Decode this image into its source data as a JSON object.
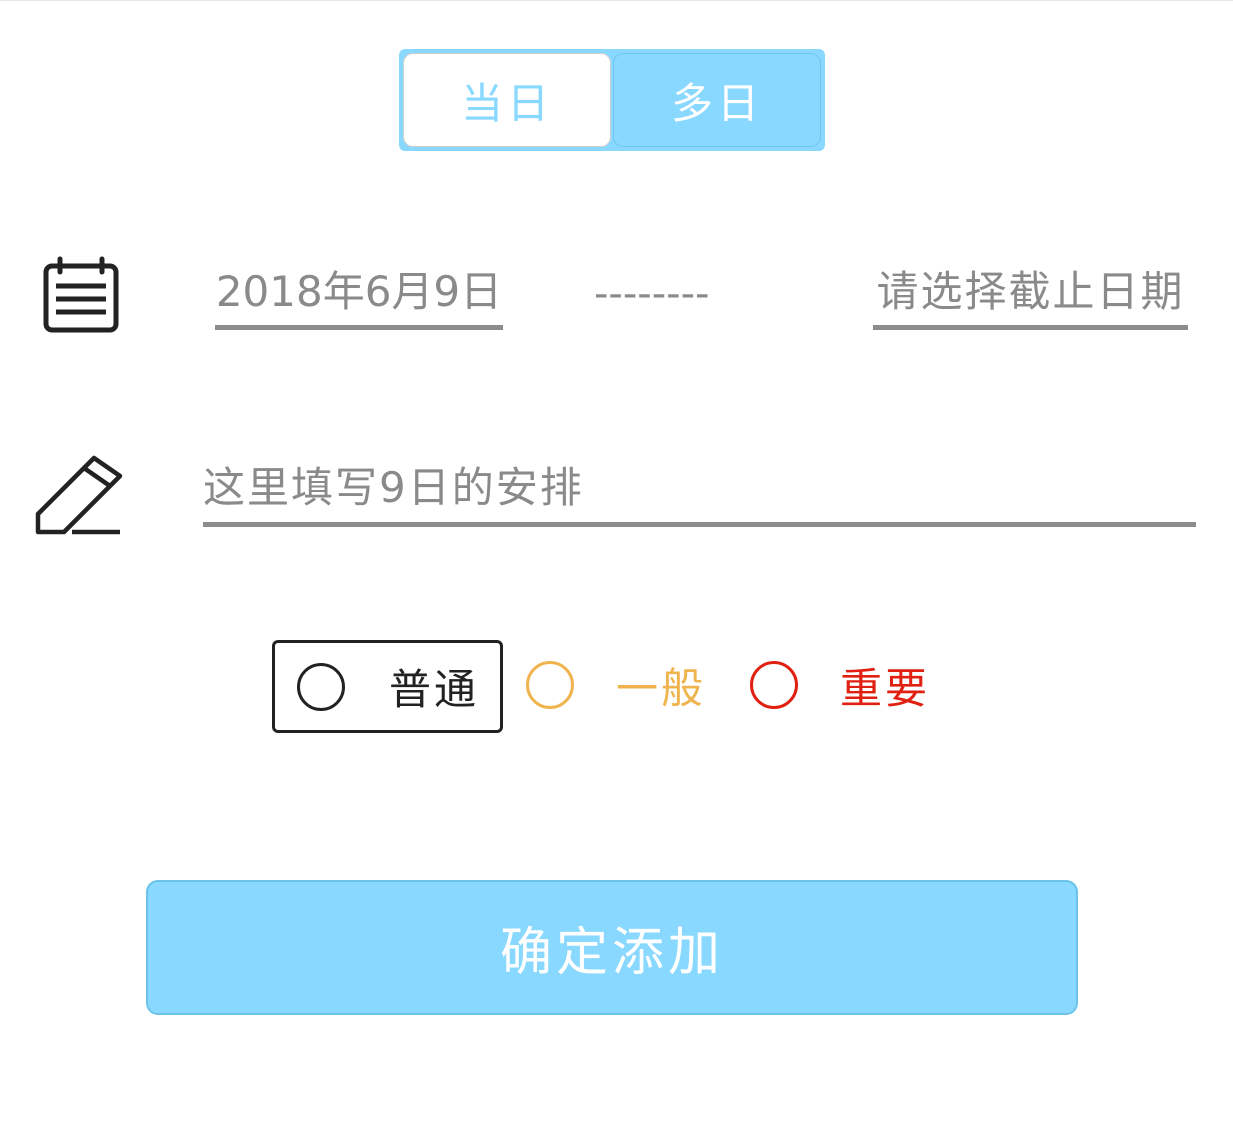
{
  "mode_toggle": {
    "single_day": "当日",
    "multi_day": "多日",
    "selected": "multi_day"
  },
  "date_range": {
    "start_date": "2018年6月9日",
    "separator": "--------",
    "end_date_placeholder": "请选择截止日期",
    "icon": "calendar-icon"
  },
  "plan": {
    "placeholder": "这里填写9日的安排",
    "value": "",
    "icon": "pencil-icon"
  },
  "priority": {
    "selected": "normal",
    "options": [
      {
        "key": "normal",
        "label": "普通",
        "color": "#222222"
      },
      {
        "key": "medium",
        "label": "一般",
        "color": "#f0b44f"
      },
      {
        "key": "important",
        "label": "重要",
        "color": "#e02010"
      }
    ]
  },
  "submit": {
    "label": "确定添加"
  },
  "colors": {
    "accent": "#88d8ff",
    "underline": "#8c8c8c",
    "muted_text": "#8a8a8a"
  }
}
